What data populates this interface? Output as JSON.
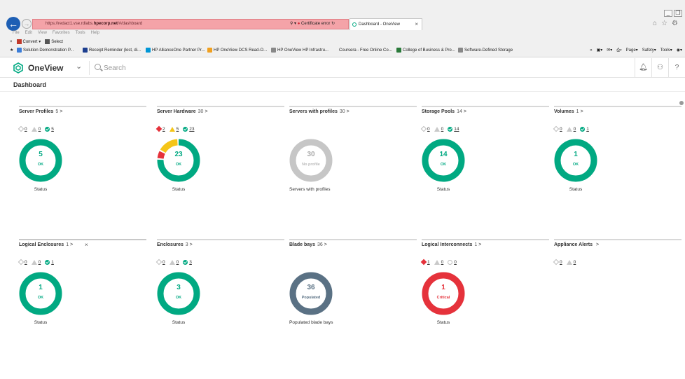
{
  "browser": {
    "address_prefix": "https://",
    "address_host": "hpecorp.net",
    "address_pre_host": "redact1.vse.rdlabs.",
    "address_path": "/#/dashboard",
    "cert_label": "Certificate error",
    "tab_label": "Dashboard - OneView",
    "menu": [
      "File",
      "Edit",
      "View",
      "Favorites",
      "Tools",
      "Help"
    ],
    "convert_label": "Convert",
    "select_label": "Select",
    "favorites": [
      {
        "label": "Solution Demonstration P...",
        "color": "#3b7dd8"
      },
      {
        "label": "Receipt Reminder (lost, di...",
        "color": "#1d3f8f"
      },
      {
        "label": "HP AllianceOne Partner Pr...",
        "color": "#0096d6"
      },
      {
        "label": "HP OneView DCS Read-O...",
        "color": "#f0a020"
      },
      {
        "label": "HP OneView",
        "color": "#888888"
      },
      {
        "label": "HP Infrastru...",
        "color": "#888888"
      },
      {
        "label": "Coursera - Free Online Co...",
        "color": "#ffffff"
      },
      {
        "label": "College of Business & Pro...",
        "color": "#2a7a3a"
      },
      {
        "label": "Software-Defined Storage",
        "color": "#888888"
      }
    ],
    "cmd": [
      "Page",
      "Safety",
      "Tools"
    ]
  },
  "app": {
    "name": "OneView",
    "search_placeholder": "Search",
    "page_title": "Dashboard"
  },
  "colors": {
    "ok": "#01a982",
    "warning": "#f5c518",
    "critical": "#e5323b",
    "no_profile": "#c6c6c6",
    "populated": "#5a7184"
  },
  "panels": [
    {
      "title": "Server Profiles",
      "count": "5",
      "arrow": ">",
      "status": {
        "critical": "0",
        "warning": "0",
        "ok": "5"
      },
      "donut": {
        "value": "5",
        "label": "OK",
        "kind": "ok"
      },
      "caption": "Status"
    },
    {
      "title": "Server Hardware",
      "count": "30",
      "arrow": ">",
      "status": {
        "critical": "2",
        "warning": "5",
        "ok": "23"
      },
      "donut": {
        "value": "23",
        "label": "OK",
        "kind": "mixed",
        "segments": {
          "critical": 2,
          "warning": 5,
          "ok": 23
        }
      },
      "caption": "Status"
    },
    {
      "title": "Servers with profiles",
      "count": "30",
      "arrow": ">",
      "status": null,
      "donut": {
        "value": "30",
        "label": "No profile",
        "kind": "none"
      },
      "caption": "Servers with profiles"
    },
    {
      "title": "Storage Pools",
      "count": "14",
      "arrow": ">",
      "status": {
        "critical": "0",
        "warning": "0",
        "ok": "14"
      },
      "donut": {
        "value": "14",
        "label": "OK",
        "kind": "ok"
      },
      "caption": "Status"
    },
    {
      "title": "Volumes",
      "count": "1",
      "arrow": ">",
      "status": {
        "critical": "0",
        "warning": "0",
        "ok": "1"
      },
      "donut": {
        "value": "1",
        "label": "OK",
        "kind": "ok"
      },
      "caption": "Status"
    },
    {
      "title": "Logical Enclosures",
      "count": "1",
      "arrow": ">",
      "close": "×",
      "status": {
        "critical": "0",
        "warning": "0",
        "ok": "1"
      },
      "donut": {
        "value": "1",
        "label": "OK",
        "kind": "ok"
      },
      "caption": "Status"
    },
    {
      "title": "Enclosures",
      "count": "3",
      "arrow": ">",
      "status": {
        "critical": "0",
        "warning": "0",
        "ok": "3"
      },
      "donut": {
        "value": "3",
        "label": "OK",
        "kind": "ok"
      },
      "caption": "Status"
    },
    {
      "title": "Blade bays",
      "count": "36",
      "arrow": ">",
      "status": null,
      "donut": {
        "value": "36",
        "label": "Populated",
        "kind": "populated"
      },
      "caption": "Populated blade bays"
    },
    {
      "title": "Logical Interconnects",
      "count": "1",
      "arrow": ">",
      "status": {
        "critical": "1",
        "warning": "0",
        "unknown": "0"
      },
      "donut": {
        "value": "1",
        "label": "Critical",
        "kind": "critical"
      },
      "caption": "Status"
    },
    {
      "title": "Appliance Alerts",
      "count": "",
      "arrow": ">",
      "status": {
        "critical": "0",
        "warning": "0"
      },
      "donut": null,
      "caption": ""
    }
  ]
}
